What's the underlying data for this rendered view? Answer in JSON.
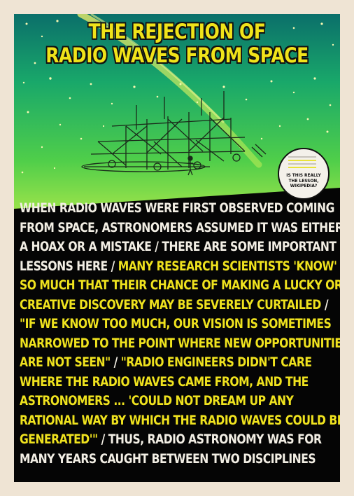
{
  "poster": {
    "title_lines": [
      "THE REJECTION OF",
      "RADIO WAVES FROM SPACE"
    ],
    "badge": {
      "lines": [
        "IS THIS REALLY",
        "THE LESSON,",
        "WIKIPEDIA?"
      ]
    },
    "body_lines": [
      {
        "segments": [
          {
            "text": "WHEN RADIO WAVES WERE FIRST OBSERVED COMING",
            "color": "white"
          }
        ]
      },
      {
        "segments": [
          {
            "text": "FROM SPACE, ASTRONOMERS ASSUMED IT WAS EITHER",
            "color": "white"
          }
        ]
      },
      {
        "segments": [
          {
            "text": "A HOAX OR A MISTAKE / THERE ARE SOME IMPORTANT",
            "color": "white"
          }
        ]
      },
      {
        "segments": [
          {
            "text": "LESSONS HERE / ",
            "color": "white"
          },
          {
            "text": "MANY RESEARCH SCIENTISTS 'KNOW'",
            "color": "yellow"
          }
        ]
      },
      {
        "segments": [
          {
            "text": "SO MUCH THAT THEIR CHANCE OF MAKING A LUCKY OR",
            "color": "yellow"
          }
        ]
      },
      {
        "segments": [
          {
            "text": "CREATIVE DISCOVERY MAY BE SEVERELY CURTAILED",
            "color": "yellow"
          },
          {
            "text": " /",
            "color": "white"
          }
        ]
      },
      {
        "segments": [
          {
            "text": "\"IF WE KNOW TOO MUCH, OUR VISION IS SOMETIMES",
            "color": "yellow"
          }
        ]
      },
      {
        "segments": [
          {
            "text": "NARROWED TO THE POINT WHERE NEW OPPORTUNITIES",
            "color": "yellow"
          }
        ]
      },
      {
        "segments": [
          {
            "text": "ARE NOT SEEN\"",
            "color": "yellow"
          },
          {
            "text": " / ",
            "color": "white"
          },
          {
            "text": "\"RADIO ENGINEERS DIDN'T CARE",
            "color": "yellow"
          }
        ]
      },
      {
        "segments": [
          {
            "text": "WHERE THE RADIO WAVES CAME FROM, AND THE",
            "color": "yellow"
          }
        ]
      },
      {
        "segments": [
          {
            "text": "ASTRONOMERS ... 'COULD NOT DREAM UP ANY",
            "color": "yellow"
          }
        ]
      },
      {
        "segments": [
          {
            "text": "RATIONAL WAY BY WHICH THE RADIO WAVES COULD BE",
            "color": "yellow"
          }
        ]
      },
      {
        "segments": [
          {
            "text": "GENERATED'\"",
            "color": "yellow"
          },
          {
            "text": " / THUS, RADIO ASTRONOMY WAS FOR",
            "color": "white"
          }
        ]
      },
      {
        "segments": [
          {
            "text": "MANY YEARS CAUGHT BETWEEN TWO DISCIPLINES",
            "color": "white"
          }
        ]
      }
    ]
  },
  "colors": {
    "background": "#efe4d4",
    "panel": "#050505",
    "accent_yellow": "#efe21e",
    "text_white": "#f2eee4",
    "sky_top": "#0b7a70",
    "sky_bottom": "#8ddf3a"
  },
  "icons": [
    "radio-antenna-array-illustration",
    "star-field",
    "milky-way-streak"
  ]
}
